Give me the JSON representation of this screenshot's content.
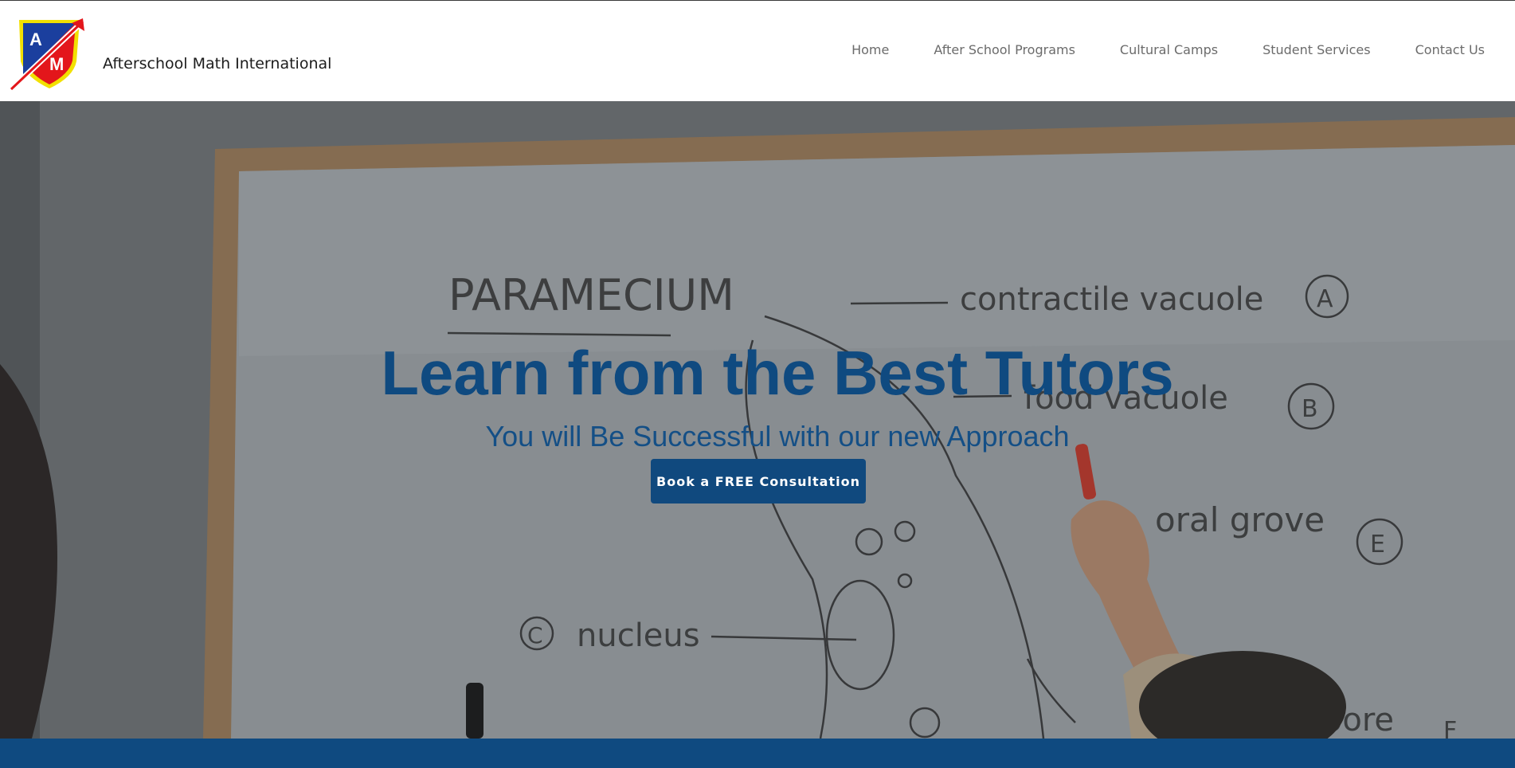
{
  "site": {
    "name": "Afterschool Math International",
    "logo_letters": [
      "A",
      "M"
    ]
  },
  "nav": {
    "items": [
      {
        "label": "Home"
      },
      {
        "label": "After School Programs"
      },
      {
        "label": "Cultural Camps"
      },
      {
        "label": "Student Services"
      },
      {
        "label": "Contact Us"
      }
    ]
  },
  "hero": {
    "title": "Learn from the Best Tutors",
    "subtitle": "You will Be Successful with our new Approach",
    "cta_label": "Book a FREE Consultation",
    "whiteboard": {
      "heading": "PARAMECIUM",
      "labels": [
        {
          "text": "contractile vacuole",
          "marker": "A"
        },
        {
          "text": "food vacuole",
          "marker": "B"
        },
        {
          "text": "nucleus",
          "marker": "C"
        },
        {
          "text": "oral grove",
          "marker": "E"
        },
        {
          "text": "pore",
          "marker": "F"
        }
      ]
    }
  },
  "colors": {
    "brand": "#0f4a80",
    "nav_text": "#6b6b6b",
    "header_bg": "#ffffff",
    "logo_red": "#e3161b",
    "logo_blue": "#1b3f9e",
    "logo_yellow": "#f2e000"
  }
}
